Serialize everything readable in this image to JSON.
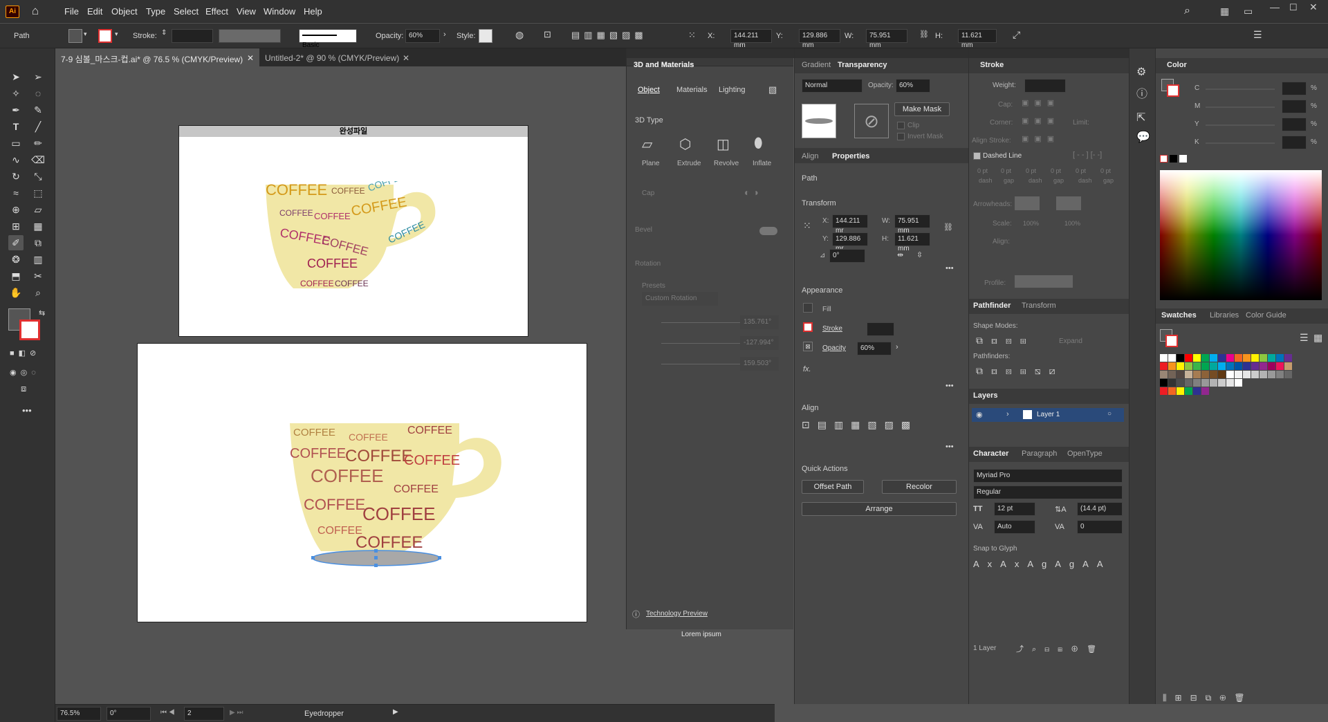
{
  "app": {
    "logo": "Ai",
    "home_icon": "home-icon"
  },
  "menu": [
    "File",
    "Edit",
    "Object",
    "Type",
    "Select",
    "Effect",
    "View",
    "Window",
    "Help"
  ],
  "control": {
    "selection": "Path",
    "stroke_label": "Stroke:",
    "brush": "Basic",
    "opacity_label": "Opacity:",
    "opacity_value": "60%",
    "style_label": "Style:",
    "x_label": "X:",
    "x_value": "144.211 mm",
    "y_label": "Y:",
    "y_value": "129.886 mm",
    "w_label": "W:",
    "w_value": "75.951 mm",
    "h_label": "H:",
    "h_value": "11.621 mm"
  },
  "tabs": [
    {
      "label": "7-9 심볼_마스크-컵.ai* @ 76.5 % (CMYK/Preview)",
      "active": true
    },
    {
      "label": "Untitled-2* @ 90 % (CMYK/Preview)",
      "active": false
    }
  ],
  "artboard1": {
    "title": "완성파일"
  },
  "cup_text": "COFFEE",
  "panel3d": {
    "title": "3D and Materials",
    "tabs": [
      "Object",
      "Materials",
      "Lighting"
    ],
    "section_type": "3D Type",
    "types": [
      "Plane",
      "Extrude",
      "Revolve",
      "Inflate"
    ],
    "cap": "Cap",
    "bevel": "Bevel",
    "rotation": "Rotation",
    "presets": "Presets",
    "preset_value": "Custom Rotation",
    "rot_x": "135.761°",
    "rot_y": "-127.994°",
    "rot_z": "159.503°",
    "tech_preview": "Technology Preview",
    "lorem": "Lorem ipsum"
  },
  "transparency": {
    "tabs": [
      "Gradient",
      "Transparency"
    ],
    "mode": "Normal",
    "opacity_label": "Opacity:",
    "opacity": "60%",
    "make_mask": "Make Mask",
    "clip": "Clip",
    "invert": "Invert Mask"
  },
  "properties": {
    "tabs": [
      "Align",
      "Properties"
    ],
    "kind": "Path",
    "transform": "Transform",
    "x_label": "X:",
    "x": "144.211 mr",
    "y_label": "Y:",
    "y": "129.886 mr",
    "w_label": "W:",
    "w": "75.951 mm",
    "h_label": "H:",
    "h": "11.621 mm",
    "angle": "0°",
    "appearance": "Appearance",
    "fill": "Fill",
    "stroke": "Stroke",
    "opacity": "Opacity",
    "opacity_value": "60%",
    "fx": "fx.",
    "align": "Align",
    "quick_actions": "Quick Actions",
    "offset_path": "Offset Path",
    "recolor": "Recolor",
    "arrange": "Arrange"
  },
  "stroke_panel": {
    "title": "Stroke",
    "weight": "Weight:",
    "cap": "Cap:",
    "corner": "Corner:",
    "limit": "Limit:",
    "align_stroke": "Align Stroke:",
    "dashed": "Dashed Line",
    "dash_labels": [
      "dash",
      "gap",
      "dash",
      "gap",
      "dash",
      "gap"
    ],
    "dash_unit": "0 pt",
    "arrowheads": "Arrowheads:",
    "scale": "Scale:",
    "scale_value": "100%",
    "align": "Align:",
    "profile": "Profile:"
  },
  "pathfinder": {
    "tabs": [
      "Pathfinder",
      "Transform"
    ],
    "shape_modes": "Shape Modes:",
    "expand": "Expand",
    "pathfinders": "Pathfinders:"
  },
  "layers": {
    "title": "Layers",
    "layer_name": "Layer 1",
    "count": "1 Layer"
  },
  "character": {
    "tabs": [
      "Character",
      "Paragraph",
      "OpenType"
    ],
    "font": "Myriad Pro",
    "style": "Regular",
    "size": "12 pt",
    "leading": "(14.4 pt)",
    "kerning": "Auto",
    "tracking": "0",
    "snap": "Snap to Glyph"
  },
  "color": {
    "title": "Color",
    "channels": [
      "C",
      "M",
      "Y",
      "K"
    ],
    "unit": "%"
  },
  "swatches": {
    "tabs": [
      "Swatches",
      "Libraries",
      "Color Guide"
    ]
  },
  "status": {
    "zoom": "76.5%",
    "angle": "0°",
    "page": "2",
    "tool": "Eyedropper"
  },
  "colors": {
    "accent": "#4a8fe0",
    "stroke_red": "#e03030",
    "cup": "#f1e7a6"
  }
}
